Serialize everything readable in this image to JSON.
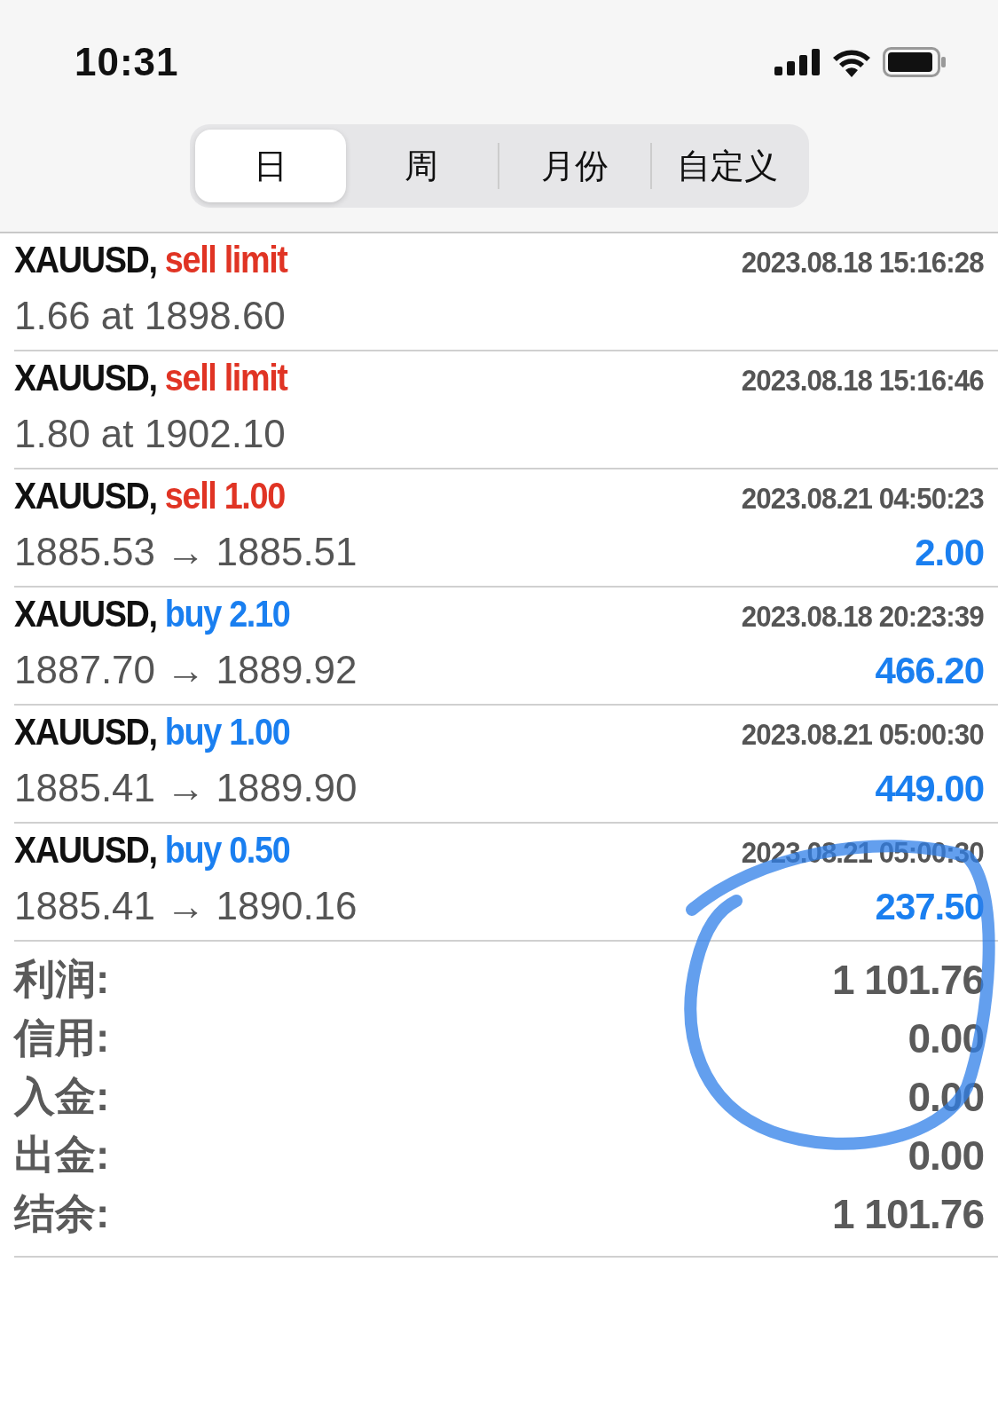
{
  "status_bar": {
    "time": "10:31"
  },
  "tabs": [
    {
      "label": "日",
      "selected": true
    },
    {
      "label": "周",
      "selected": false
    },
    {
      "label": "月份",
      "selected": false
    },
    {
      "label": "自定义",
      "selected": false
    }
  ],
  "deals": [
    {
      "symbol": "XAUUSD,",
      "action": "sell limit",
      "kind": "sell",
      "time": "2023.08.18 15:16:28",
      "detail": "1.66 at 1898.60"
    },
    {
      "symbol": "XAUUSD,",
      "action": "sell limit",
      "kind": "sell",
      "time": "2023.08.18 15:16:46",
      "detail": "1.80 at 1902.10"
    },
    {
      "symbol": "XAUUSD,",
      "action": "sell 1.00",
      "kind": "sell",
      "time": "2023.08.21 04:50:23",
      "detail": "1885.53 → 1885.51",
      "profit": "2.00"
    },
    {
      "symbol": "XAUUSD,",
      "action": "buy 2.10",
      "kind": "buy",
      "time": "2023.08.18 20:23:39",
      "detail": "1887.70 → 1889.92",
      "profit": "466.20"
    },
    {
      "symbol": "XAUUSD,",
      "action": "buy 1.00",
      "kind": "buy",
      "time": "2023.08.21 05:00:30",
      "detail": "1885.41 → 1889.90",
      "profit": "449.00"
    },
    {
      "symbol": "XAUUSD,",
      "action": "buy 0.50",
      "kind": "buy",
      "time": "2023.08.21 05:00:30",
      "detail": "1885.41 → 1890.16",
      "profit": "237.50"
    }
  ],
  "summary": [
    {
      "label": "利润:",
      "value": "1 101.76"
    },
    {
      "label": "信用:",
      "value": "0.00"
    },
    {
      "label": "入金:",
      "value": "0.00"
    },
    {
      "label": "出金:",
      "value": "0.00"
    },
    {
      "label": "结余:",
      "value": "1 101.76"
    }
  ]
}
